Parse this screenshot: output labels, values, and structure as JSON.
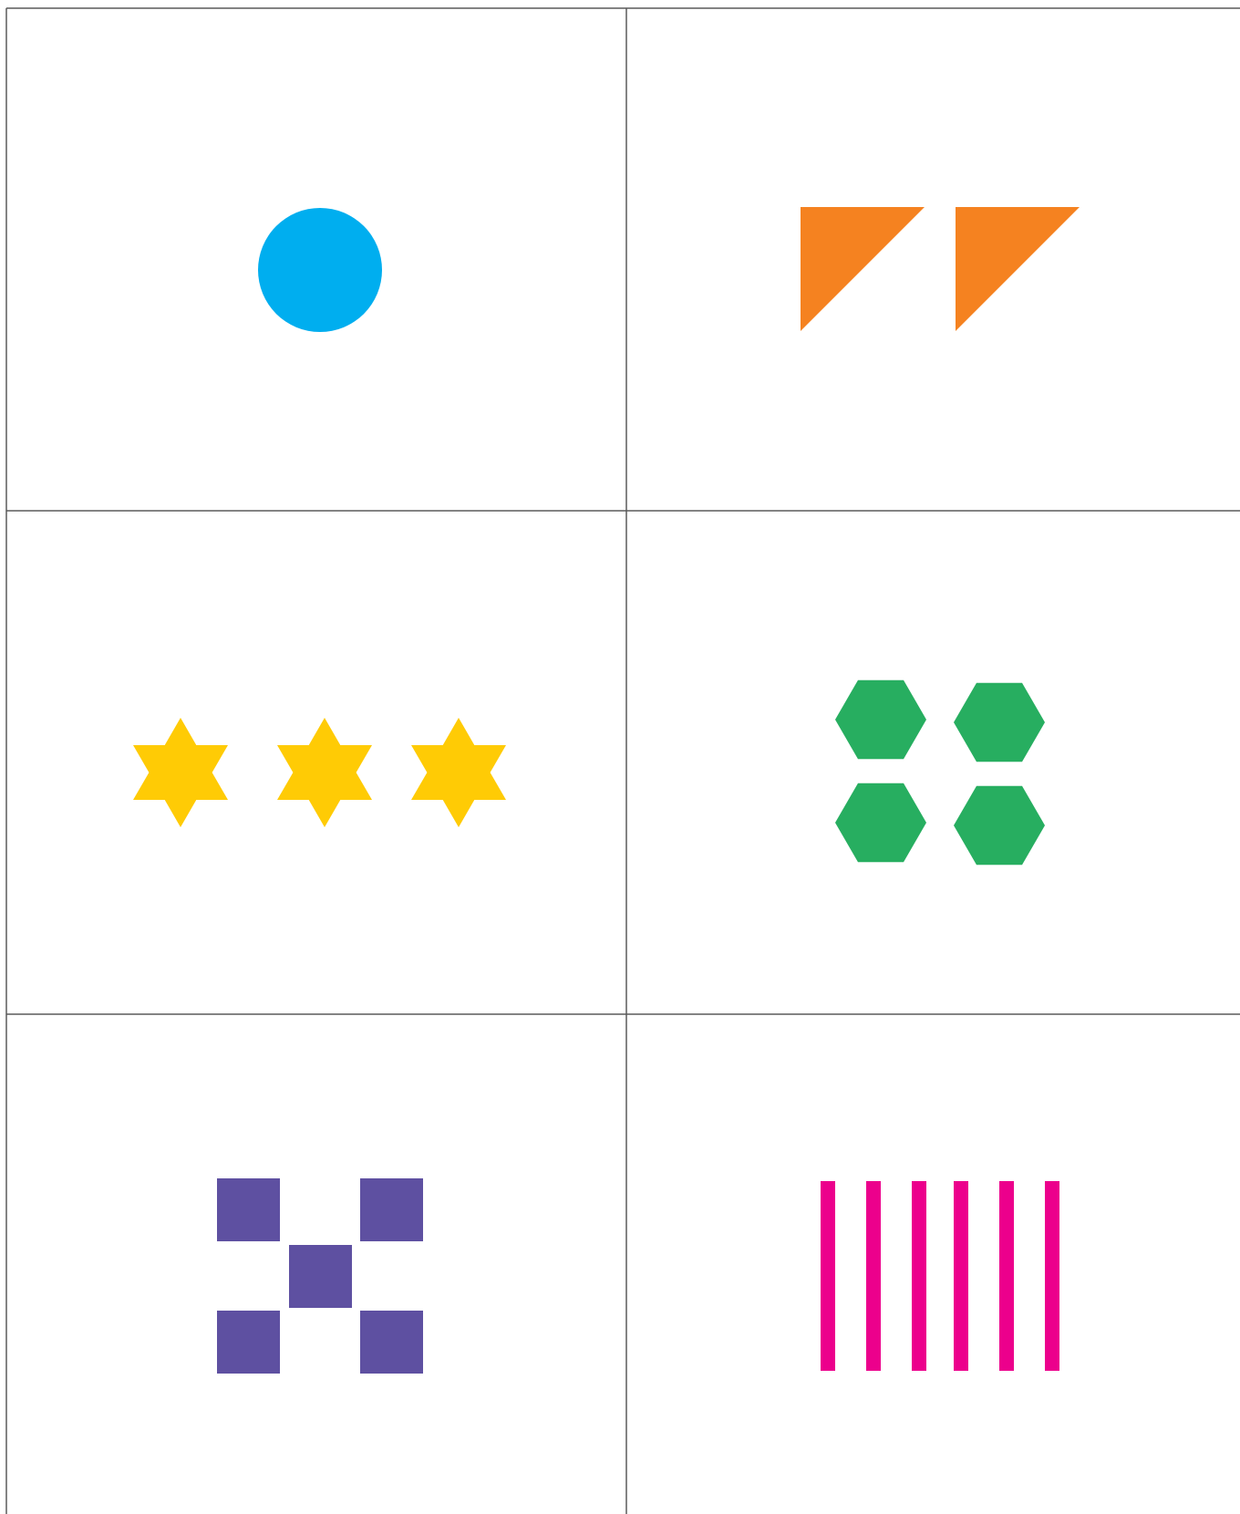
{
  "cards": [
    {
      "id": "card-one",
      "shape": "circle",
      "count": 1,
      "color": "#00aeef"
    },
    {
      "id": "card-two",
      "shape": "right-triangle",
      "count": 2,
      "color": "#f58220"
    },
    {
      "id": "card-three",
      "shape": "six-point-star",
      "count": 3,
      "color": "#ffcb05"
    },
    {
      "id": "card-four",
      "shape": "hexagon",
      "count": 4,
      "color": "#27ae60"
    },
    {
      "id": "card-five",
      "shape": "square",
      "count": 5,
      "color": "#5e50a1"
    },
    {
      "id": "card-six",
      "shape": "vertical-bar",
      "count": 6,
      "color": "#ec008c"
    }
  ],
  "grid_line_color": "#5a5a5a"
}
